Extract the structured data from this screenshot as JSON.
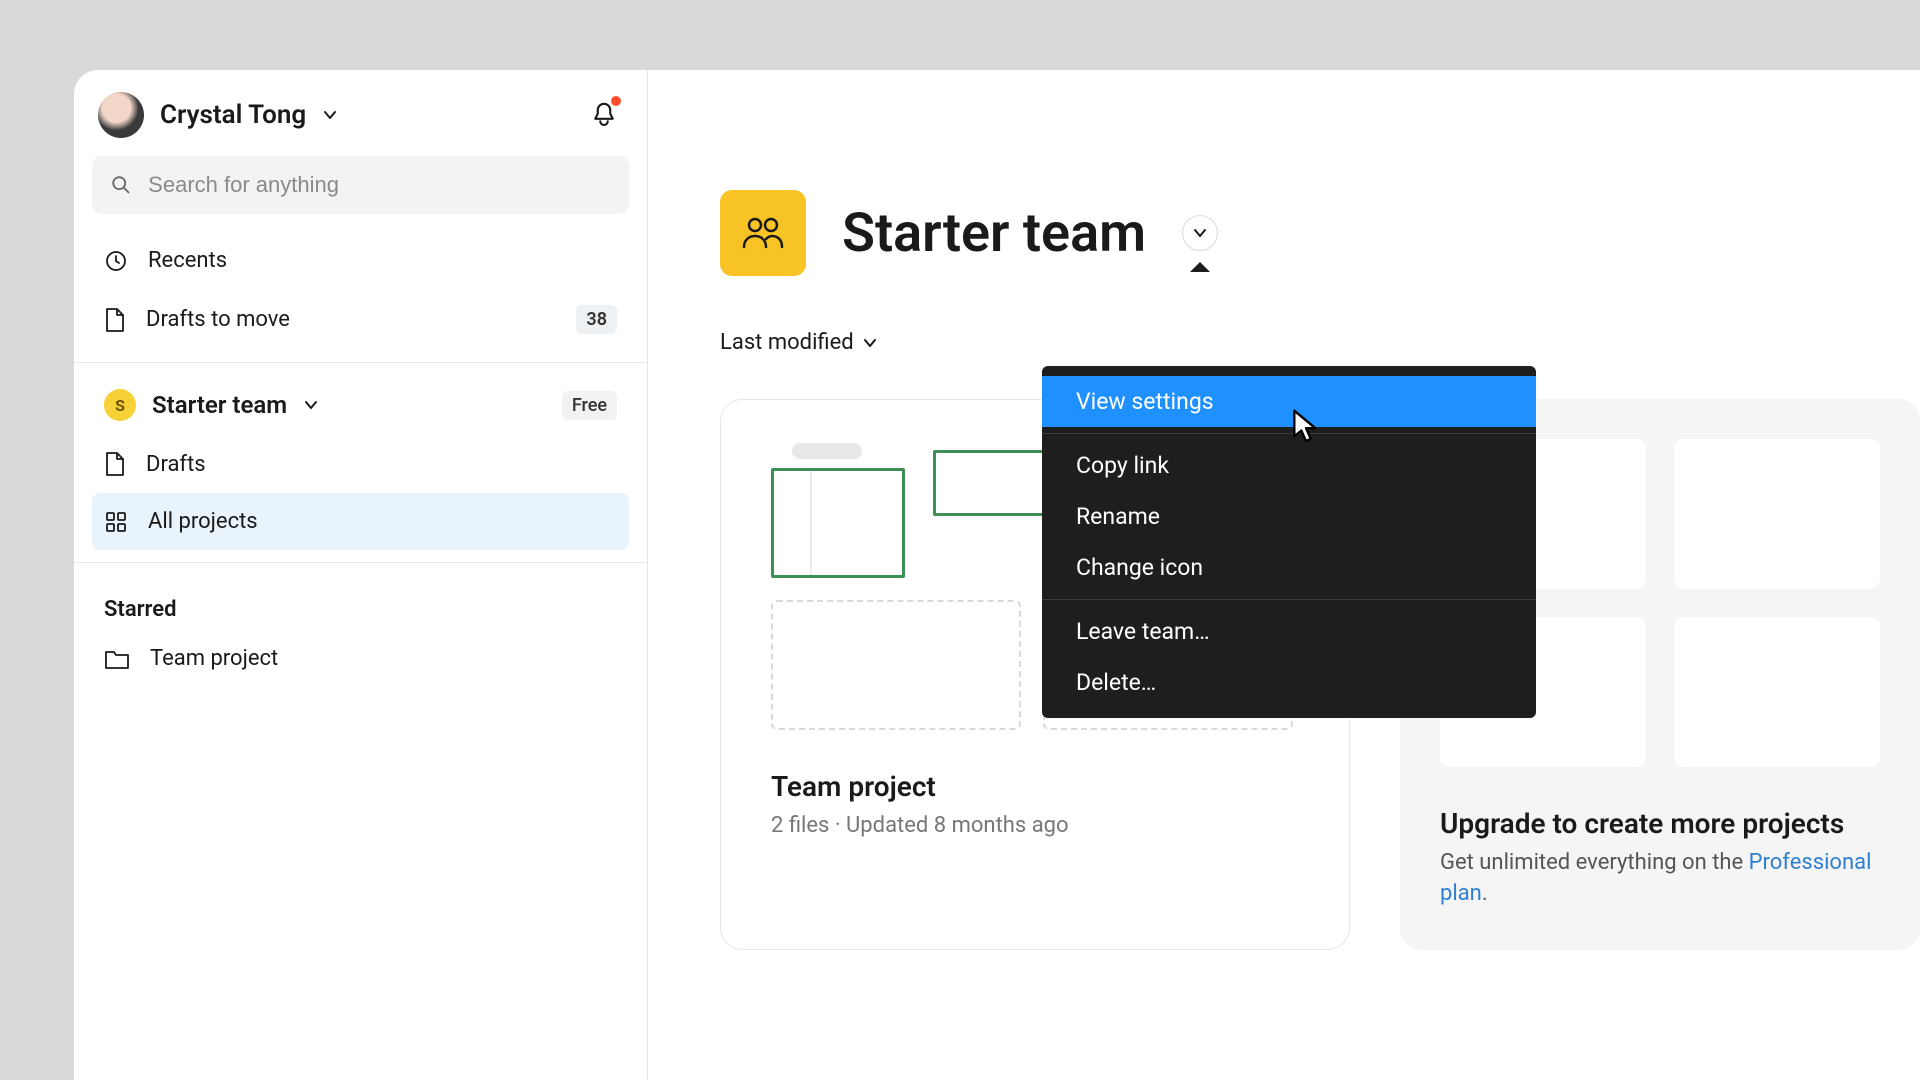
{
  "user": {
    "name": "Crystal Tong"
  },
  "search": {
    "placeholder": "Search for anything"
  },
  "nav": {
    "recents": "Recents",
    "drafts_to_move": "Drafts to move",
    "drafts_badge": "38"
  },
  "team": {
    "name": "Starter team",
    "plan_badge": "Free",
    "drafts": "Drafts",
    "all_projects": "All projects",
    "initial": "S"
  },
  "starred": {
    "label": "Starred",
    "items": [
      "Team project"
    ]
  },
  "main": {
    "title": "Starter team",
    "sort_label": "Last modified"
  },
  "project": {
    "name": "Team project",
    "meta": "2 files · Updated 8 months ago"
  },
  "upgrade": {
    "title": "Upgrade to create more projects",
    "sub_prefix": "Get unlimited everything on the ",
    "link_text": "Professional plan",
    "sub_suffix": "."
  },
  "menu": {
    "view_settings": "View settings",
    "copy_link": "Copy link",
    "rename": "Rename",
    "change_icon": "Change icon",
    "leave_team": "Leave team…",
    "delete": "Delete…"
  }
}
